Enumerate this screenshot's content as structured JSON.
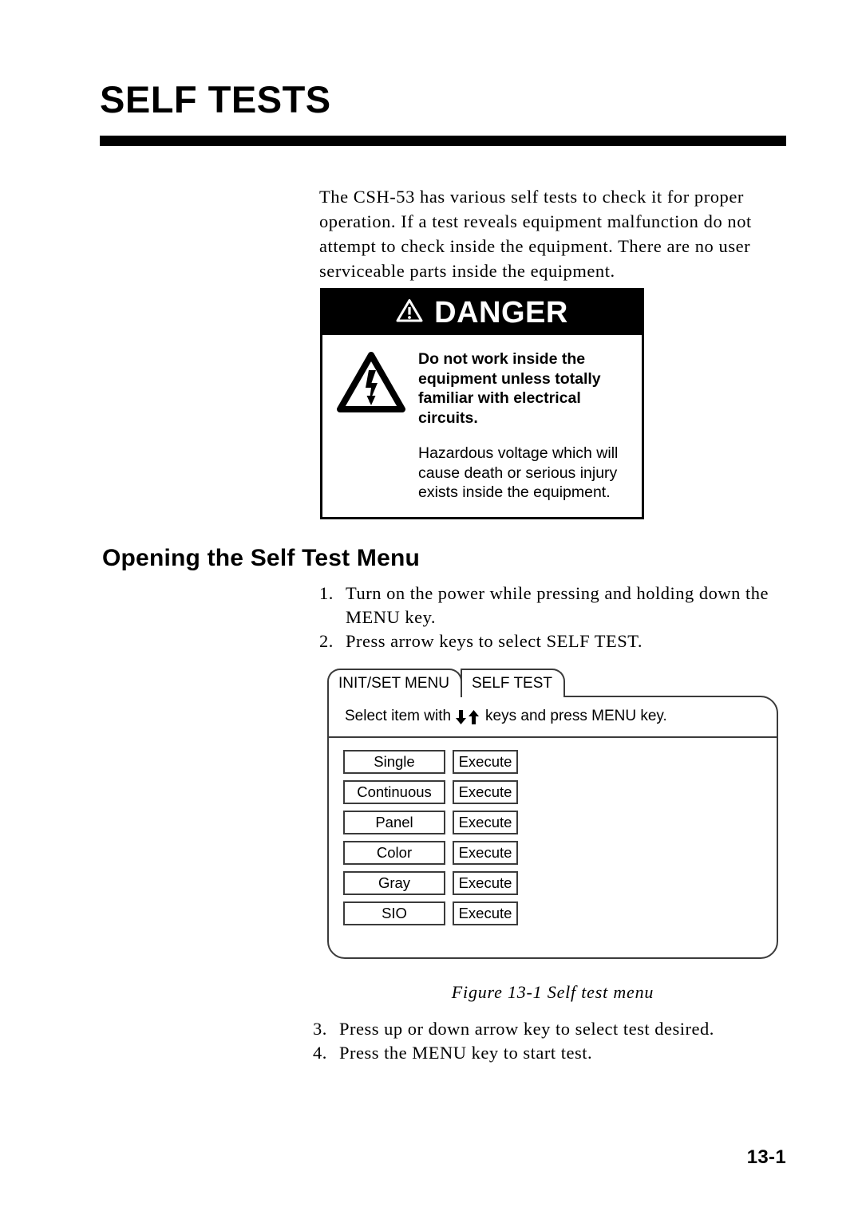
{
  "chapter": {
    "title": "SELF TESTS"
  },
  "intro": {
    "paragraph": "The CSH-53 has various self tests to check it for proper operation. If a test reveals equipment malfunction do not attempt to check inside the equipment. There are no user serviceable parts inside the equipment."
  },
  "danger": {
    "header_label": "DANGER",
    "header_icon": "warning-triangle-icon",
    "body_icon": "electric-shock-triangle-icon",
    "lead_text": "Do not work inside the equipment unless totally familiar with electrical circuits.",
    "detail_text": "Hazardous voltage which will cause death or serious injury exists inside the equipment."
  },
  "section": {
    "heading": "Opening the Self Test Menu"
  },
  "steps_top": [
    {
      "number": "1.",
      "text": "Turn on the power while pressing and holding down the MENU key."
    },
    {
      "number": "2.",
      "text": "Press arrow keys to select SELF TEST."
    }
  ],
  "steps_bottom": [
    {
      "number": "3.",
      "text": "Press up or down arrow key to select test desired."
    },
    {
      "number": "4.",
      "text": "Press the MENU key to start test."
    }
  ],
  "menu_figure": {
    "tabs": [
      {
        "label": "INIT/SET MENU"
      },
      {
        "label": "SELF TEST"
      }
    ],
    "hint_prefix": "Select item with",
    "hint_suffix": "keys and press MENU key.",
    "arrow_down_icon": "arrow-down-icon",
    "arrow_up_icon": "arrow-up-icon",
    "execute_label": "Execute",
    "rows": [
      {
        "label": "Single",
        "action": "Execute"
      },
      {
        "label": "Continuous",
        "action": "Execute"
      },
      {
        "label": "Panel",
        "action": "Execute"
      },
      {
        "label": "Color",
        "action": "Execute"
      },
      {
        "label": "Gray",
        "action": "Execute"
      },
      {
        "label": "SIO",
        "action": "Execute"
      }
    ],
    "caption": "Figure 13-1 Self test menu"
  },
  "footer": {
    "page_number": "13-1"
  },
  "colors": {
    "ink": "#000000",
    "paper": "#ffffff",
    "screen_line": "#3b3b3b"
  }
}
